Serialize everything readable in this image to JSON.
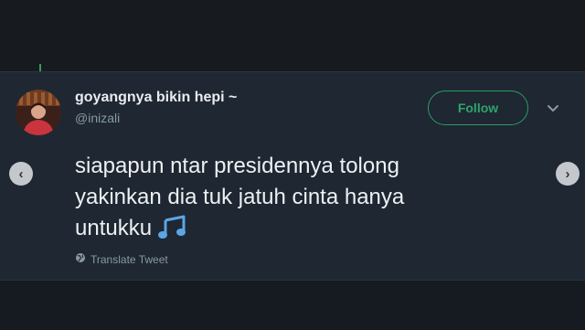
{
  "tweet": {
    "display_name": "goyangnya bikin hepi ~",
    "handle": "@inizali",
    "follow_label": "Follow",
    "text_lines": [
      "siapapun ntar presidennya tolong",
      "yakinkan dia tuk jatuh cinta hanya",
      "untukku"
    ],
    "translate_label": "Translate Tweet"
  },
  "icons": {
    "caret": "chevron-down-icon",
    "music": "music-notes-icon",
    "globe": "globe-icon",
    "prev": "chevron-left-icon",
    "next": "chevron-right-icon"
  },
  "colors": {
    "card_bg": "#1e2732",
    "page_bg": "#161b21",
    "accent_green": "#2fa36b",
    "text_primary": "#eef1f3",
    "text_secondary": "#8899a6",
    "music_blue": "#5aa6e6"
  }
}
